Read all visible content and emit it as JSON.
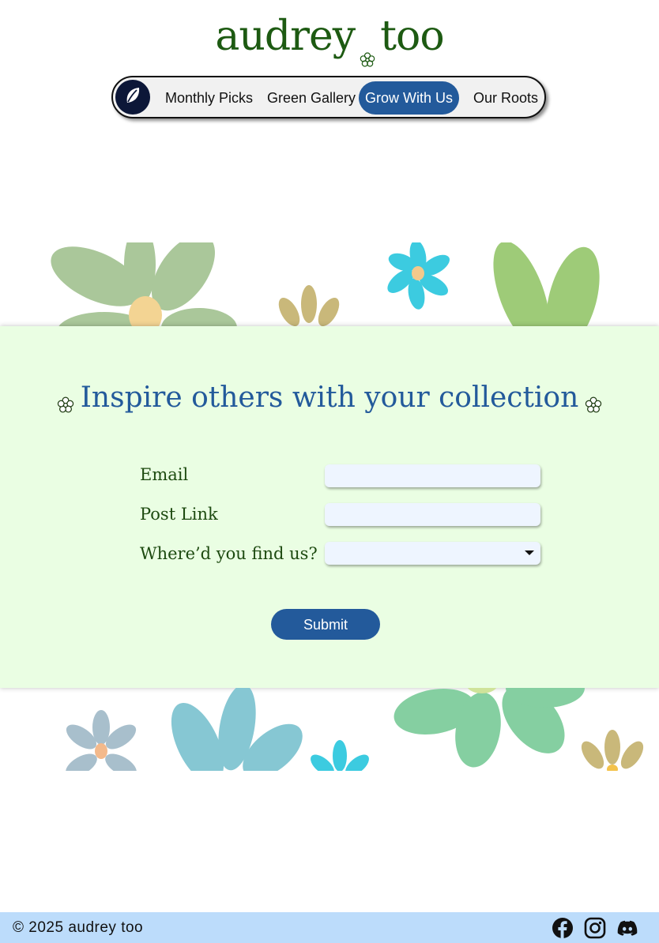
{
  "brand": {
    "name_left": "audrey",
    "name_right": "too",
    "flower_icon": "flower-icon",
    "color": "#1d5a12"
  },
  "nav": {
    "logo_icon": "leaf-icon",
    "items": [
      {
        "label": "Monthly Picks",
        "active": false
      },
      {
        "label": "Green Gallery",
        "active": false
      },
      {
        "label": "Grow With Us",
        "active": true
      },
      {
        "label": "Our Roots",
        "active": false
      }
    ],
    "active_color": "#235a9b"
  },
  "form": {
    "title": "Inspire others with your collection",
    "title_color": "#235a9b",
    "background": "#eafee3",
    "fields": [
      {
        "label": "Email",
        "type": "text",
        "value": "",
        "placeholder": ""
      },
      {
        "label": "Post Link",
        "type": "text",
        "value": "",
        "placeholder": ""
      },
      {
        "label": "Where’d you find us?",
        "type": "select",
        "value": ""
      }
    ],
    "submit_label": "Submit"
  },
  "footer": {
    "copyright": "© 2025 audrey too",
    "background": "#bcdcfb",
    "social_icons": [
      "facebook-icon",
      "instagram-icon",
      "discord-icon"
    ]
  }
}
